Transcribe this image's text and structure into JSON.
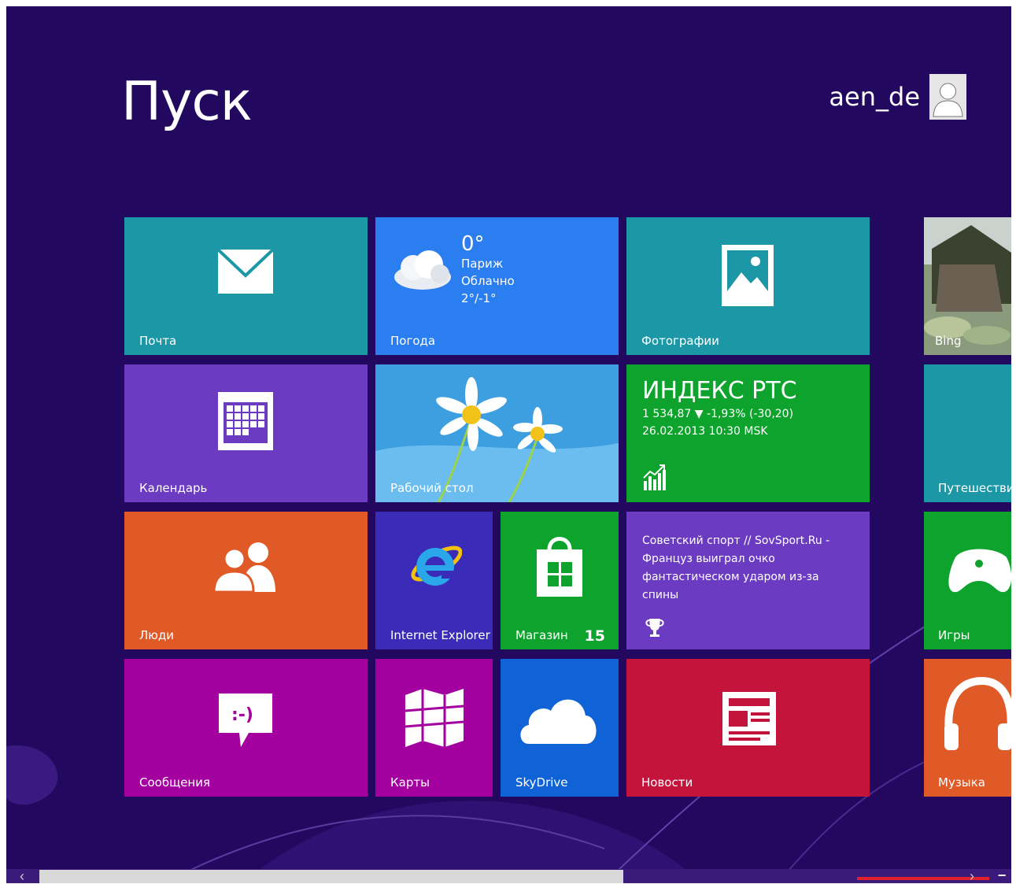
{
  "header": {
    "title": "Пуск",
    "user_name": "aen_de"
  },
  "tiles": {
    "mail": {
      "label": "Почта",
      "color": "#1b97a6"
    },
    "weather": {
      "label": "Погода",
      "temp": "0°",
      "city": "Париж",
      "condition": "Облачно",
      "range": "2°/-1°",
      "color": "#2a7ef0"
    },
    "photos": {
      "label": "Фотографии",
      "color": "#1b97a6"
    },
    "bing": {
      "label": "Bing"
    },
    "calendar": {
      "label": "Календарь",
      "color": "#6b3bc2"
    },
    "desktop": {
      "label": "Рабочий стол"
    },
    "finance": {
      "title": "ИНДЕКС РТС",
      "line1": "1 534,87 ▼ -1,93% (-30,20)",
      "line2": "26.02.2013 10:30 MSK",
      "color": "#0ea32d"
    },
    "travel": {
      "label": "Путешествия",
      "color": "#1b97a6"
    },
    "people": {
      "label": "Люди",
      "color": "#e05a28"
    },
    "ie": {
      "label": "Internet Explorer",
      "color": "#3a2bb8"
    },
    "store": {
      "label": "Магазин",
      "badge": "15",
      "color": "#0ea32d"
    },
    "sport": {
      "text": "Советский спорт // SovSport.Ru - Француз выиграл очко фантастическом ударом из-за спины",
      "color": "#6b3bc2"
    },
    "games": {
      "label": "Игры",
      "color": "#0ea32d"
    },
    "messaging": {
      "label": "Сообщения",
      "color": "#a3009f"
    },
    "maps": {
      "label": "Карты",
      "color": "#a3009f"
    },
    "skydrive": {
      "label": "SkyDrive",
      "color": "#1063d6"
    },
    "news": {
      "label": "Новости",
      "color": "#c4143c"
    },
    "music": {
      "label": "Музыка",
      "color": "#e05a28"
    }
  },
  "scrollbar": {
    "left_arrow": "‹",
    "right_arrow": "›",
    "zoom": "−",
    "position": 0.6
  }
}
